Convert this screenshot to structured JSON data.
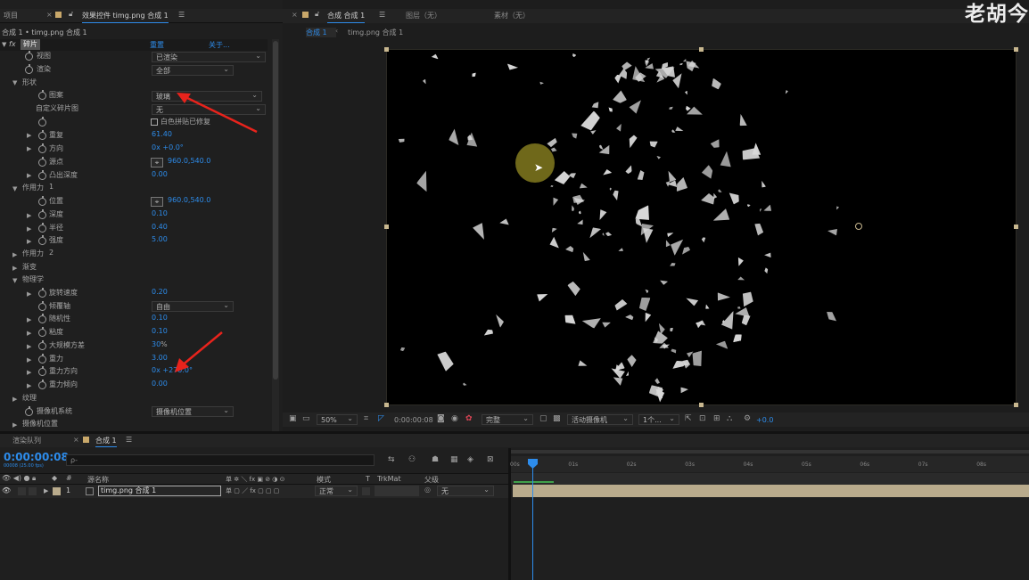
{
  "watermark": "老胡今",
  "left_panel": {
    "tabs": [
      "项目",
      "效果控件 timg.png 合成 1"
    ],
    "breadcrumb": "合成 1 • timg.png 合成 1",
    "effect": {
      "name": "碎片",
      "reset": "重置",
      "about": "关于..."
    }
  },
  "props": {
    "view": {
      "label": "视图",
      "value": "已渲染"
    },
    "render": {
      "label": "渲染",
      "value": "全部"
    },
    "shape": "形状",
    "pattern": {
      "label": "图案",
      "value": "玻璃"
    },
    "custom": {
      "label": "自定义碎片图",
      "value": "无"
    },
    "white_fix": "白色拼贴已修复",
    "repeat": {
      "label": "重复",
      "value": "61.40"
    },
    "direction": {
      "label": "方向",
      "value": "0x +0.0°"
    },
    "origin": {
      "label": "源点",
      "value": "960.0,540.0"
    },
    "extrusion": {
      "label": "凸出深度",
      "value": "0.00"
    },
    "force1": {
      "label": "作用力",
      "num": "1"
    },
    "position": {
      "label": "位置",
      "value": "960.0,540.0"
    },
    "depth": {
      "label": "深度",
      "value": "0.10"
    },
    "radius": {
      "label": "半径",
      "value": "0.40"
    },
    "strength": {
      "label": "强度",
      "value": "5.00"
    },
    "force2": {
      "label": "作用力",
      "num": "2"
    },
    "gradient": "渐变",
    "physics": "物理学",
    "rot_speed": {
      "label": "旋转速度",
      "value": "0.20"
    },
    "tumble": {
      "label": "倾覆轴",
      "value": "自由"
    },
    "randomness": {
      "label": "随机性",
      "value": "0.10"
    },
    "viscosity": {
      "label": "粘度",
      "value": "0.10"
    },
    "mass_var": {
      "label": "大规模方差",
      "value": "30",
      "unit": "%"
    },
    "gravity": {
      "label": "重力",
      "value": "3.00"
    },
    "gravity_dir": {
      "label": "重力方向",
      "value": "0x +270.0°"
    },
    "gravity_inc": {
      "label": "重力倾向",
      "value": "0.00"
    },
    "texture": "纹理",
    "camera_system": {
      "label": "摄像机系统",
      "value": "摄像机位置"
    },
    "camera_pos": "摄像机位置"
  },
  "comp_panel": {
    "tab": "合成 合成 1",
    "layer_tab": "图层（无）",
    "footage_tab": "素材（无）",
    "sub_tabs": [
      "合成 1",
      "timg.png 合成 1"
    ]
  },
  "viewer_bar": {
    "zoom": "50%",
    "time": "0:00:00:08",
    "quality": "完整",
    "camera": "活动摄像机",
    "views": "1个...",
    "exposure": "+0.0"
  },
  "timeline": {
    "tabs": [
      "渲染队列",
      "合成 1"
    ],
    "timecode": "0:00:00:08",
    "fps": "00008 (25.00 fps)",
    "search_placeholder": "ρ-",
    "headers": {
      "source": "源名称",
      "switches": "单 ✲ ＼ fx ▣ ⊘ ◑ ⊙",
      "mode": "模式",
      "t": "T",
      "trkmat": "TrkMat",
      "parent": "父级"
    },
    "layer": {
      "num": "1",
      "name": "timg.png 合成 1",
      "mode": "正常",
      "parent": "无"
    },
    "ruler": [
      "00s",
      "01s",
      "02s",
      "03s",
      "04s",
      "05s",
      "06s",
      "07s",
      "08s"
    ]
  },
  "colors": {
    "accent": "#2d8ceb",
    "arrow": "#e8231c",
    "layer_bar": "#b9ab8c"
  }
}
